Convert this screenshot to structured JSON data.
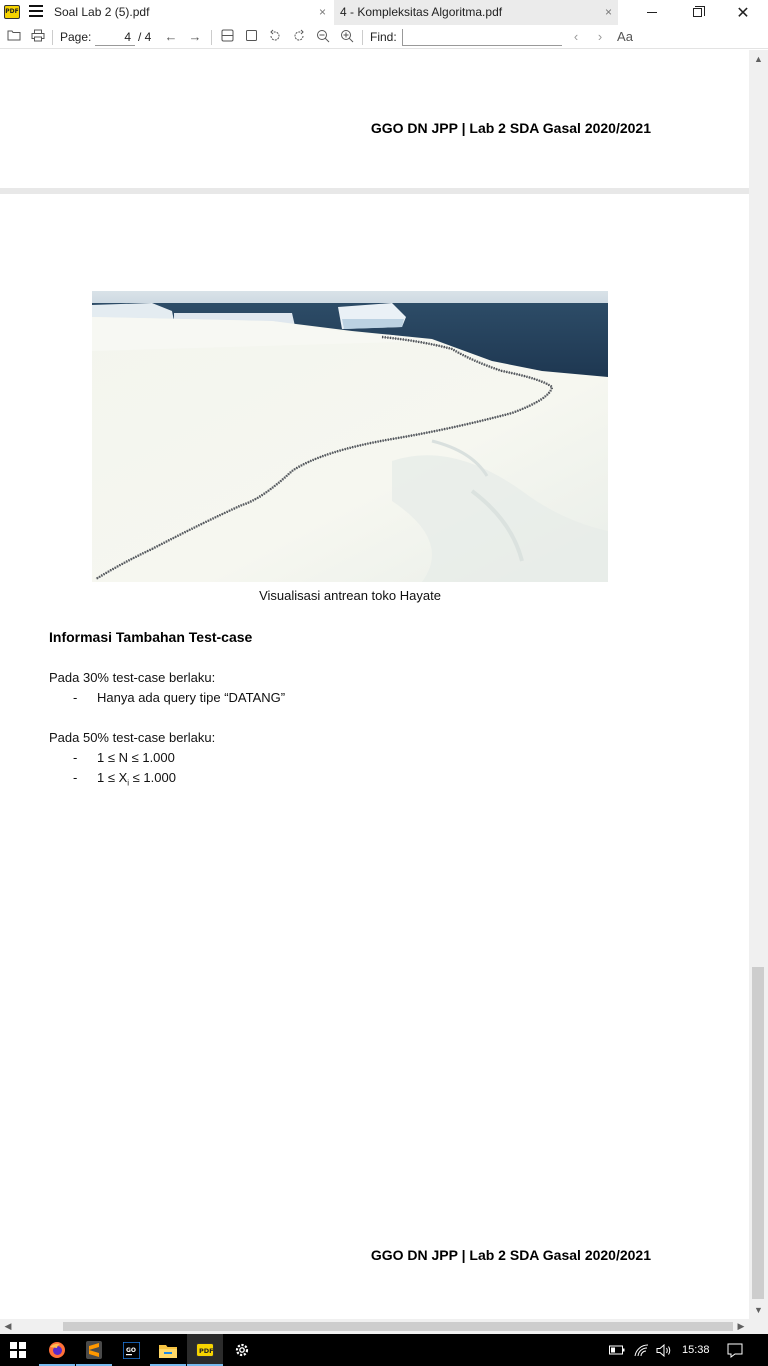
{
  "window": {
    "tabs": [
      {
        "label": "Soal Lab 2 (5).pdf",
        "close": "×"
      },
      {
        "label": "4 - Kompleksitas Algoritma.pdf",
        "close": "×"
      }
    ],
    "app_logo": "PDF",
    "controls": {
      "minimize": "minimize-icon",
      "maximize": "restore-icon",
      "close": "✕"
    }
  },
  "toolbar": {
    "page_label": "Page:",
    "page_value": "4",
    "page_total": "/ 4",
    "find_label": "Find:",
    "find_value": "",
    "match_case": "Aa"
  },
  "document": {
    "header_top": "GGO DN JPP | Lab 2 SDA Gasal 2020/2021",
    "caption": "Visualisasi antrean toko Hayate",
    "heading": "Informasi Tambahan Test-case",
    "section1": {
      "intro": "Pada 30% test-case berlaku:",
      "bullets": [
        "Hanya ada query tipe “DATANG”"
      ]
    },
    "section2": {
      "intro": "Pada 50% test-case berlaku:",
      "bullet1": "1 ≤ N ≤ 1.000",
      "bullet2_pre": "1 ≤ X",
      "bullet2_sub": "i",
      "bullet2_post": " ≤ 1.000"
    },
    "dash": "-",
    "header_bottom": "GGO DN JPP | Lab 2 SDA Gasal 2020/2021"
  },
  "taskbar": {
    "time": "15:38",
    "apps": [
      "start-icon",
      "firefox-icon",
      "sublime-text-icon",
      "goland-icon",
      "file-explorer-icon",
      "pdf-reader-icon",
      "settings-icon"
    ]
  },
  "colors": {
    "tab_inactive": "#ebebeb",
    "page_gap": "#e8e8e8",
    "taskbar": "#000000",
    "pdf_logo": "#f7d400"
  }
}
